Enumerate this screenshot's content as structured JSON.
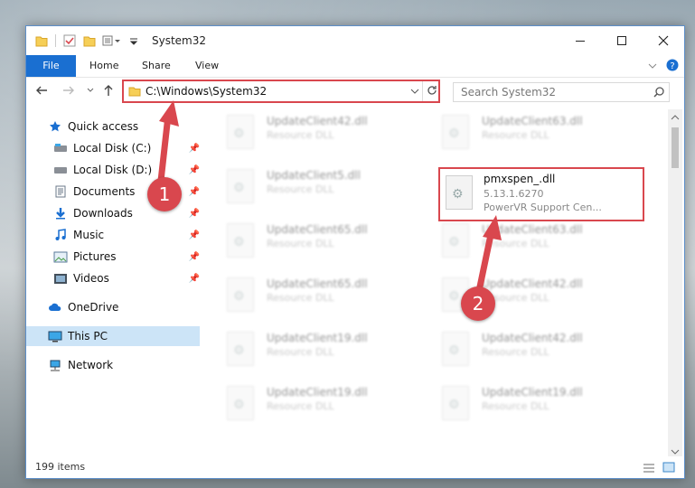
{
  "window": {
    "title": "System32"
  },
  "ribbon": {
    "tabs": [
      "File",
      "Home",
      "Share",
      "View"
    ]
  },
  "address": {
    "path": "C:\\Windows\\System32"
  },
  "search": {
    "placeholder": "Search System32"
  },
  "sidebar": {
    "items": [
      {
        "label": "Quick access",
        "icon": "star-icon"
      },
      {
        "label": "Local Disk (C:)",
        "icon": "drive-icon",
        "pinned": true
      },
      {
        "label": "Local Disk (D:)",
        "icon": "drive-icon",
        "pinned": true
      },
      {
        "label": "Documents",
        "icon": "documents-icon",
        "pinned": true
      },
      {
        "label": "Downloads",
        "icon": "download-icon",
        "pinned": true
      },
      {
        "label": "Music",
        "icon": "music-icon",
        "pinned": true
      },
      {
        "label": "Pictures",
        "icon": "pictures-icon",
        "pinned": true
      },
      {
        "label": "Videos",
        "icon": "videos-icon",
        "pinned": true
      },
      {
        "label": "OneDrive",
        "icon": "cloud-icon"
      },
      {
        "label": "This PC",
        "icon": "computer-icon",
        "selected": true
      },
      {
        "label": "Network",
        "icon": "network-icon"
      }
    ]
  },
  "files": [
    {
      "name": "UpdateClient42.dll",
      "desc": "Resource DLL"
    },
    {
      "name": "UpdateClient63.dll",
      "desc": "Resource DLL"
    },
    {
      "name": "UpdateClient5.dll",
      "desc": "Resource DLL"
    },
    {
      "name": "pmxspen_.dll",
      "desc": "5.13.1.6270",
      "desc2": "PowerVR Support Cen...",
      "highlighted": true
    },
    {
      "name": "UpdateClient65.dll",
      "desc": "Resource DLL"
    },
    {
      "name": "UpdateClient63.dll",
      "desc": "Resource DLL"
    },
    {
      "name": "UpdateClient65.dll",
      "desc": "Resource DLL"
    },
    {
      "name": "UpdateClient42.dll",
      "desc": "Resource DLL"
    },
    {
      "name": "UpdateClient19.dll",
      "desc": "Resource DLL"
    },
    {
      "name": "UpdateClient42.dll",
      "desc": "Resource DLL"
    },
    {
      "name": "UpdateClient19.dll",
      "desc": "Resource DLL"
    },
    {
      "name": "UpdateClient19.dll",
      "desc": "Resource DLL"
    }
  ],
  "status": {
    "count": "199 items"
  },
  "annotations": {
    "step1": "1",
    "step2": "2"
  },
  "colors": {
    "accent": "#1a6fd1",
    "highlight": "#d9474e",
    "selection": "#cce4f7"
  }
}
